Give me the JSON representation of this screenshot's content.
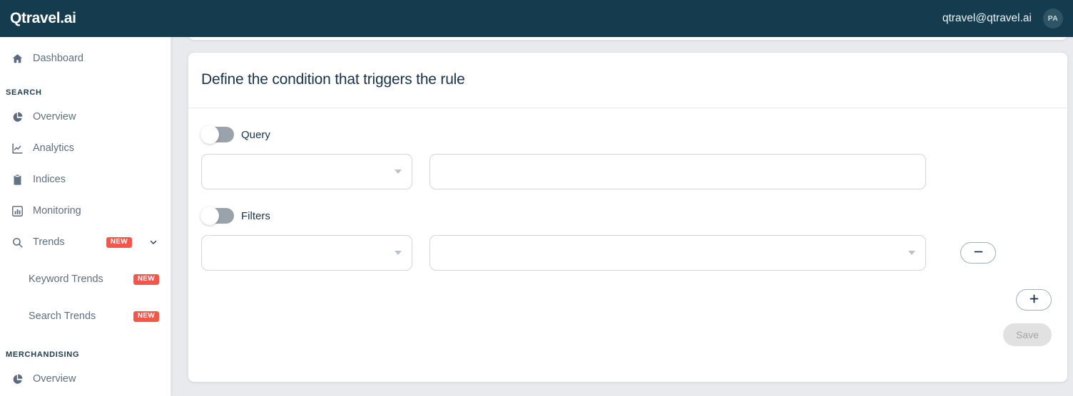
{
  "topbar": {
    "logo": "Qtravel.ai",
    "user_email": "qtravel@qtravel.ai",
    "avatar_initials": "PA",
    "background": "#143c4e"
  },
  "sidebar": {
    "dashboard": {
      "label": "Dashboard",
      "icon": "home-icon"
    },
    "sections": [
      {
        "title": "SEARCH",
        "items": [
          {
            "label": "Overview",
            "icon": "pie-chart-icon",
            "badge": "",
            "chevron": false
          },
          {
            "label": "Analytics",
            "icon": "line-chart-icon",
            "badge": "",
            "chevron": false
          },
          {
            "label": "Indices",
            "icon": "clipboard-icon",
            "badge": "",
            "chevron": false
          },
          {
            "label": "Monitoring",
            "icon": "bar-chart-icon",
            "badge": "",
            "chevron": false
          },
          {
            "label": "Trends",
            "icon": "search-icon",
            "badge": "NEW",
            "chevron": true
          }
        ],
        "subitems": [
          {
            "label": "Keyword Trends",
            "badge": "NEW"
          },
          {
            "label": "Search Trends",
            "badge": "NEW"
          }
        ]
      },
      {
        "title": "MERCHANDISING",
        "items": [
          {
            "label": "Overview",
            "icon": "pie-chart-icon",
            "badge": "",
            "chevron": false
          }
        ],
        "subitems": []
      }
    ],
    "badge_color": "#f4564a"
  },
  "card": {
    "title": "Define the condition that triggers the rule",
    "query": {
      "toggle_label": "Query",
      "toggle_on": false,
      "select_value": "",
      "select_placeholder": "",
      "text_value": "",
      "text_placeholder": ""
    },
    "filters": {
      "toggle_label": "Filters",
      "toggle_on": false,
      "select_value": "",
      "select_placeholder": "",
      "value_value": "",
      "value_placeholder": "",
      "remove_label": "—"
    },
    "add_label": "+",
    "save_label": "Save",
    "save_enabled": false
  }
}
